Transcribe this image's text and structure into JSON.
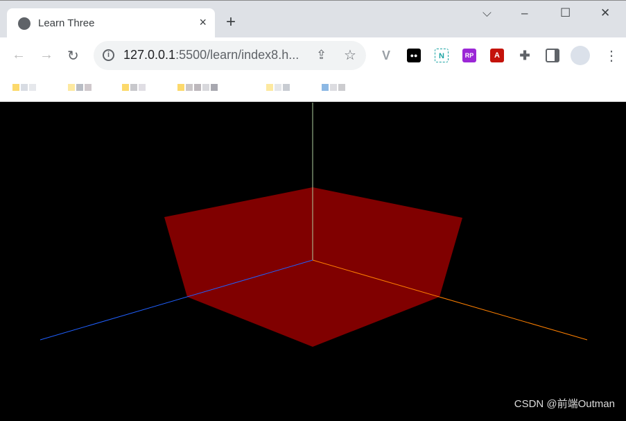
{
  "browser": {
    "tab_title": "Learn Three",
    "tab_close": "×",
    "new_tab": "+",
    "window_controls": {
      "dropdown": "⌵",
      "minimize": "–",
      "maximize": "☐",
      "close": "✕"
    },
    "url_host": "127.0.0.1",
    "url_rest": ":5500/learn/index8.h...",
    "nav": {
      "back": "←",
      "forward": "→",
      "reload": "↻"
    },
    "menu": "⋮"
  },
  "extensions": [
    {
      "name": "vue-devtools-icon",
      "label": "V",
      "color": "#9aa0a6"
    },
    {
      "name": "tampermonkey-icon",
      "label": "●●",
      "color": "#000000"
    },
    {
      "name": "n-extension-icon",
      "label": "N",
      "color": "#1aa3a3"
    },
    {
      "name": "axure-rp-icon",
      "label": "RP",
      "color": "#9b27d6"
    },
    {
      "name": "acrobat-icon",
      "label": "A",
      "color": "#c4120a"
    }
  ],
  "scene": {
    "background": "#000000",
    "box_color": "#800000",
    "axis_colors": {
      "x": "#ff8000",
      "y": "#b0d0a0",
      "z": "#2060ff"
    }
  },
  "watermark": "CSDN @前端Outman"
}
